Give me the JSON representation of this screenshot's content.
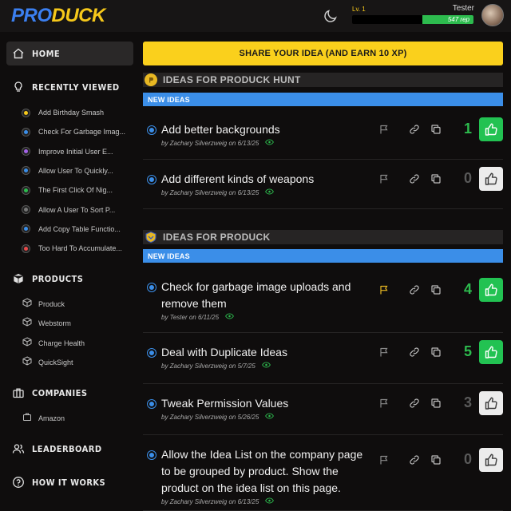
{
  "app": {
    "logo_part1": "PRO",
    "logo_part2": "DUCK"
  },
  "user": {
    "level": "Lv. 1",
    "name": "Tester",
    "rep": "547 rep",
    "xp_fraction": 0.42
  },
  "sidebar": {
    "home": "HOME",
    "recently_viewed": "RECENTLY VIEWED",
    "recent": [
      {
        "label": "Add Birthday Smash",
        "color": "#f6c81a"
      },
      {
        "label": "Check For Garbage Imag...",
        "color": "#3b8ee8"
      },
      {
        "label": "Improve Initial User E...",
        "color": "#a463e8"
      },
      {
        "label": "Allow User To Quickly...",
        "color": "#3b8ee8"
      },
      {
        "label": "The First Click Of Nig...",
        "color": "#2dbb4e"
      },
      {
        "label": "Allow A User To Sort P...",
        "color": "#777777"
      },
      {
        "label": "Add Copy Table Functio...",
        "color": "#3b8ee8"
      },
      {
        "label": "Too Hard To Accumulate...",
        "color": "#e84a4a"
      }
    ],
    "products_label": "PRODUCTS",
    "products": [
      "Produck",
      "Webstorm",
      "Charge Health",
      "QuickSight"
    ],
    "companies_label": "COMPANIES",
    "companies": [
      "Amazon"
    ],
    "leaderboard": "LEADERBOARD",
    "how_it_works": "HOW IT WORKS"
  },
  "share_button": "SHARE YOUR IDEA (AND EARN 10 XP)",
  "sections": [
    {
      "title": "IDEAS FOR PRODUCK HUNT",
      "new_label": "NEW IDEAS",
      "ideas": [
        {
          "title": "Add better backgrounds",
          "meta": "by Zachary Silverzweig on 6/13/25",
          "count": "1",
          "voted": true,
          "flagged": false
        },
        {
          "title": "Add different kinds of weapons",
          "meta": "by Zachary Silverzweig on 6/13/25",
          "count": "0",
          "voted": false,
          "flagged": false
        }
      ]
    },
    {
      "title": "IDEAS FOR PRODUCK",
      "new_label": "NEW IDEAS",
      "ideas": [
        {
          "title": "Check for garbage image uploads and remove them",
          "meta": "by Tester on 6/11/25",
          "count": "4",
          "voted": true,
          "flagged": true
        },
        {
          "title": "Deal with Duplicate Ideas",
          "meta": "by Zachary Silverzweig on 5/7/25",
          "count": "5",
          "voted": true,
          "flagged": false
        },
        {
          "title": "Tweak Permission Values",
          "meta": "by Zachary Silverzweig on 5/26/25",
          "count": "3",
          "voted": false,
          "flagged": false
        },
        {
          "title": "Allow the Idea List on the company page to be grouped by product. Show the product on the idea list on this page.",
          "meta": "by Zachary Silverzweig on 6/13/25",
          "count": "0",
          "voted": false,
          "flagged": false
        }
      ]
    }
  ],
  "colors": {
    "accent_yellow": "#fad01c",
    "accent_blue": "#3b8ee8",
    "vote_green": "#22c252",
    "bg": "#0f0d0d"
  }
}
